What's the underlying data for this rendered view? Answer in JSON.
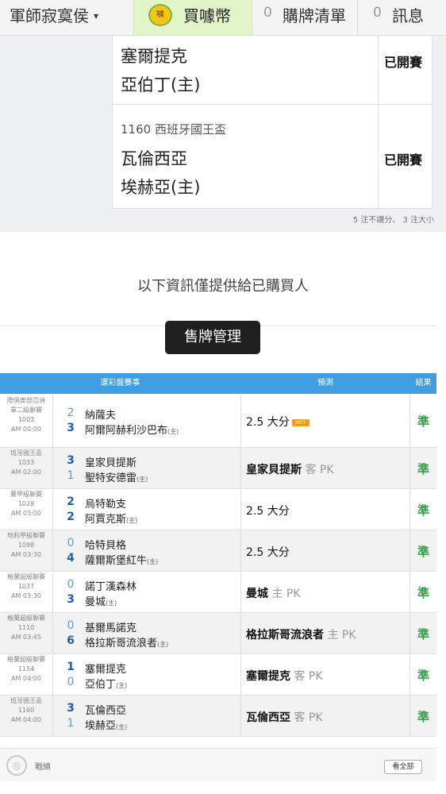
{
  "nav": {
    "user": "軍師寂寞侯",
    "caret": "▾",
    "coin_icon_text": "噱",
    "coin_label": "買噱幣",
    "cart_count": "0",
    "cart_label": "購牌清單",
    "msg_count": "0",
    "msg_label": "訊息"
  },
  "matches": [
    {
      "league": "",
      "home": "塞爾提克",
      "away": "亞伯丁(主)",
      "status": "已開賽"
    },
    {
      "league": "1160 西班牙國王盃",
      "home": "瓦倫西亞",
      "away": "埃赫亞(主)",
      "status": "已開賽"
    }
  ],
  "summary": "5 注不讓分、 3 注大小",
  "info_text": "以下資訊僅提供給已購買人",
  "sell_button": "售牌管理",
  "table": {
    "headers": [
      "運彩盤賽事",
      "預測",
      "結果"
    ],
    "home_mark": "(主)",
    "hot_badge": "HOT",
    "rows": [
      {
        "league": "際俱樂部亞洲",
        "league2": "軍二級聯賽",
        "code": "1003",
        "time": "AM 00:00",
        "score1": "2",
        "team1": "納薩夫",
        "score2": "3",
        "team2": "阿爾阿赫利沙巴布",
        "pred_main": "2.5 大分",
        "pred_sub": "",
        "hot": true,
        "result": "準"
      },
      {
        "league": "班牙國王盃",
        "league2": "",
        "code": "1033",
        "time": "AM 02:00",
        "score1": "3",
        "team1": "皇家貝提斯",
        "score2": "1",
        "team2": "聖特安德雷",
        "pred_main": "皇家貝提斯",
        "pred_sub": "客 PK",
        "hot": false,
        "result": "準"
      },
      {
        "league": "蘭甲級聯賽",
        "league2": "",
        "code": "1029",
        "time": "AM 03:00",
        "score1": "2",
        "team1": "烏特勒支",
        "score2": "2",
        "team2": "阿賈克斯",
        "pred_main": "2.5 大分",
        "pred_sub": "",
        "hot": false,
        "result": "準"
      },
      {
        "league": "地利甲級聯賽",
        "league2": "",
        "code": "1098",
        "time": "AM 03:30",
        "score1": "0",
        "team1": "哈特貝格",
        "score2": "4",
        "team2": "薩爾斯堡紅牛",
        "pred_main": "2.5 大分",
        "pred_sub": "",
        "hot": false,
        "result": "準"
      },
      {
        "league": "格蘭超級聯賽",
        "league2": "",
        "code": "1037",
        "time": "AM 03:30",
        "score1": "0",
        "team1": "諾丁漢森林",
        "score2": "3",
        "team2": "曼城",
        "pred_main": "曼城",
        "pred_sub": "主 PK",
        "hot": false,
        "result": "準"
      },
      {
        "league": "格蘭超級聯賽",
        "league2": "",
        "code": "1110",
        "time": "AM 03:45",
        "score1": "0",
        "team1": "基爾馬諾克",
        "score2": "6",
        "team2": "格拉斯哥流浪者",
        "pred_main": "格拉斯哥流浪者",
        "pred_sub": "主 PK",
        "hot": false,
        "result": "準"
      },
      {
        "league": "格蘭超級聯賽",
        "league2": "",
        "code": "1154",
        "time": "AM 04:00",
        "score1": "1",
        "team1": "塞爾提克",
        "score2": "0",
        "team2": "亞伯丁",
        "pred_main": "塞爾提克",
        "pred_sub": "客 PK",
        "hot": false,
        "result": "準"
      },
      {
        "league": "班牙國王盃",
        "league2": "",
        "code": "1160",
        "time": "AM 04:00",
        "score1": "3",
        "team1": "瓦倫西亞",
        "score2": "1",
        "team2": "埃赫亞",
        "pred_main": "瓦倫西亞",
        "pred_sub": "客 PK",
        "hot": false,
        "result": "準"
      }
    ]
  },
  "footer": {
    "record_label": "戰績",
    "see_all": "看全部"
  },
  "colors": {
    "header_blue": "#3e9ee1",
    "result_green": "#2aa34a",
    "coin_tab": "#e2f5c9",
    "sell_button_bg": "#1f1f1f"
  }
}
